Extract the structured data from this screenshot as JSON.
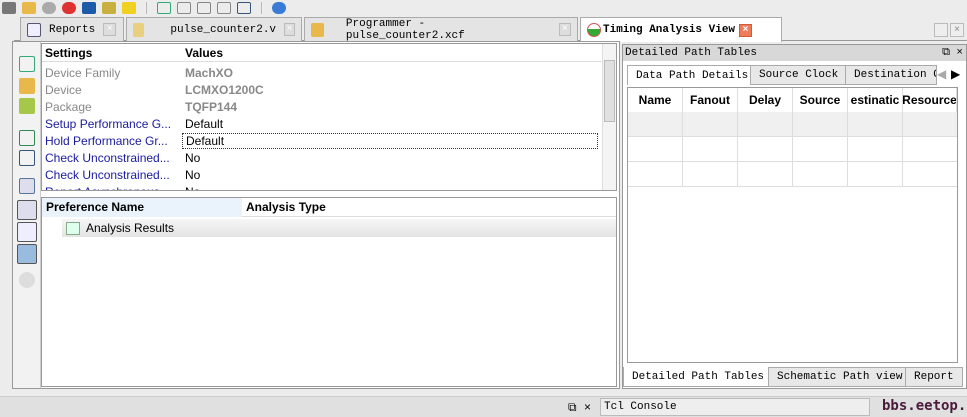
{
  "toolbar": {
    "icons": [
      "gear-icon",
      "chip-icon",
      "disabled-icon",
      "refresh-icon",
      "text-a-icon",
      "run-icon",
      "wand-icon",
      "add-panel-icon",
      "panel-icon",
      "step-icon",
      "swap-icon",
      "layout-icon",
      "globe-icon"
    ]
  },
  "tabs": [
    {
      "label": "Reports",
      "icon": "reports-icon"
    },
    {
      "label": "pulse_counter2.v",
      "icon": "edit-icon"
    },
    {
      "label": "Programmer - pulse_counter2.xcf",
      "icon": "chip-icon"
    },
    {
      "label": "Timing Analysis View",
      "icon": "timing-icon",
      "active": true
    }
  ],
  "close_glyph": "×",
  "settings": {
    "header": {
      "settings": "Settings",
      "values": "Values"
    },
    "rows": [
      {
        "key": "Device Family",
        "value": "MachXO",
        "disabled": true
      },
      {
        "key": "Device",
        "value": "LCMXO1200C",
        "disabled": true
      },
      {
        "key": "Package",
        "value": "TQFP144",
        "disabled": true
      },
      {
        "key": "Setup Performance G...",
        "value": "Default"
      },
      {
        "key": "Hold Performance Gr...",
        "value": "Default"
      },
      {
        "key": "Check Unconstrained...",
        "value": "No"
      },
      {
        "key": "Check Unconstrained...",
        "value": "No"
      },
      {
        "key": "Report Asynchronous...",
        "value": "No"
      }
    ]
  },
  "preferences": {
    "header": {
      "name": "Preference Name",
      "type": "Analysis Type"
    },
    "rows": [
      {
        "name": "Analysis Results"
      }
    ]
  },
  "right_panel": {
    "title": "Detailed Path Tables",
    "tabs": [
      "Data Path Details",
      "Source Clock",
      "Destination C"
    ],
    "columns": [
      "Name",
      "Fanout",
      "Delay",
      "Source",
      "estinatic",
      "Resource"
    ],
    "bottom_tabs": [
      "Detailed Path Tables",
      "Schematic Path view",
      "Report"
    ]
  },
  "status": {
    "console": "Tcl Console",
    "watermark": "bbs.eetop.cn"
  }
}
